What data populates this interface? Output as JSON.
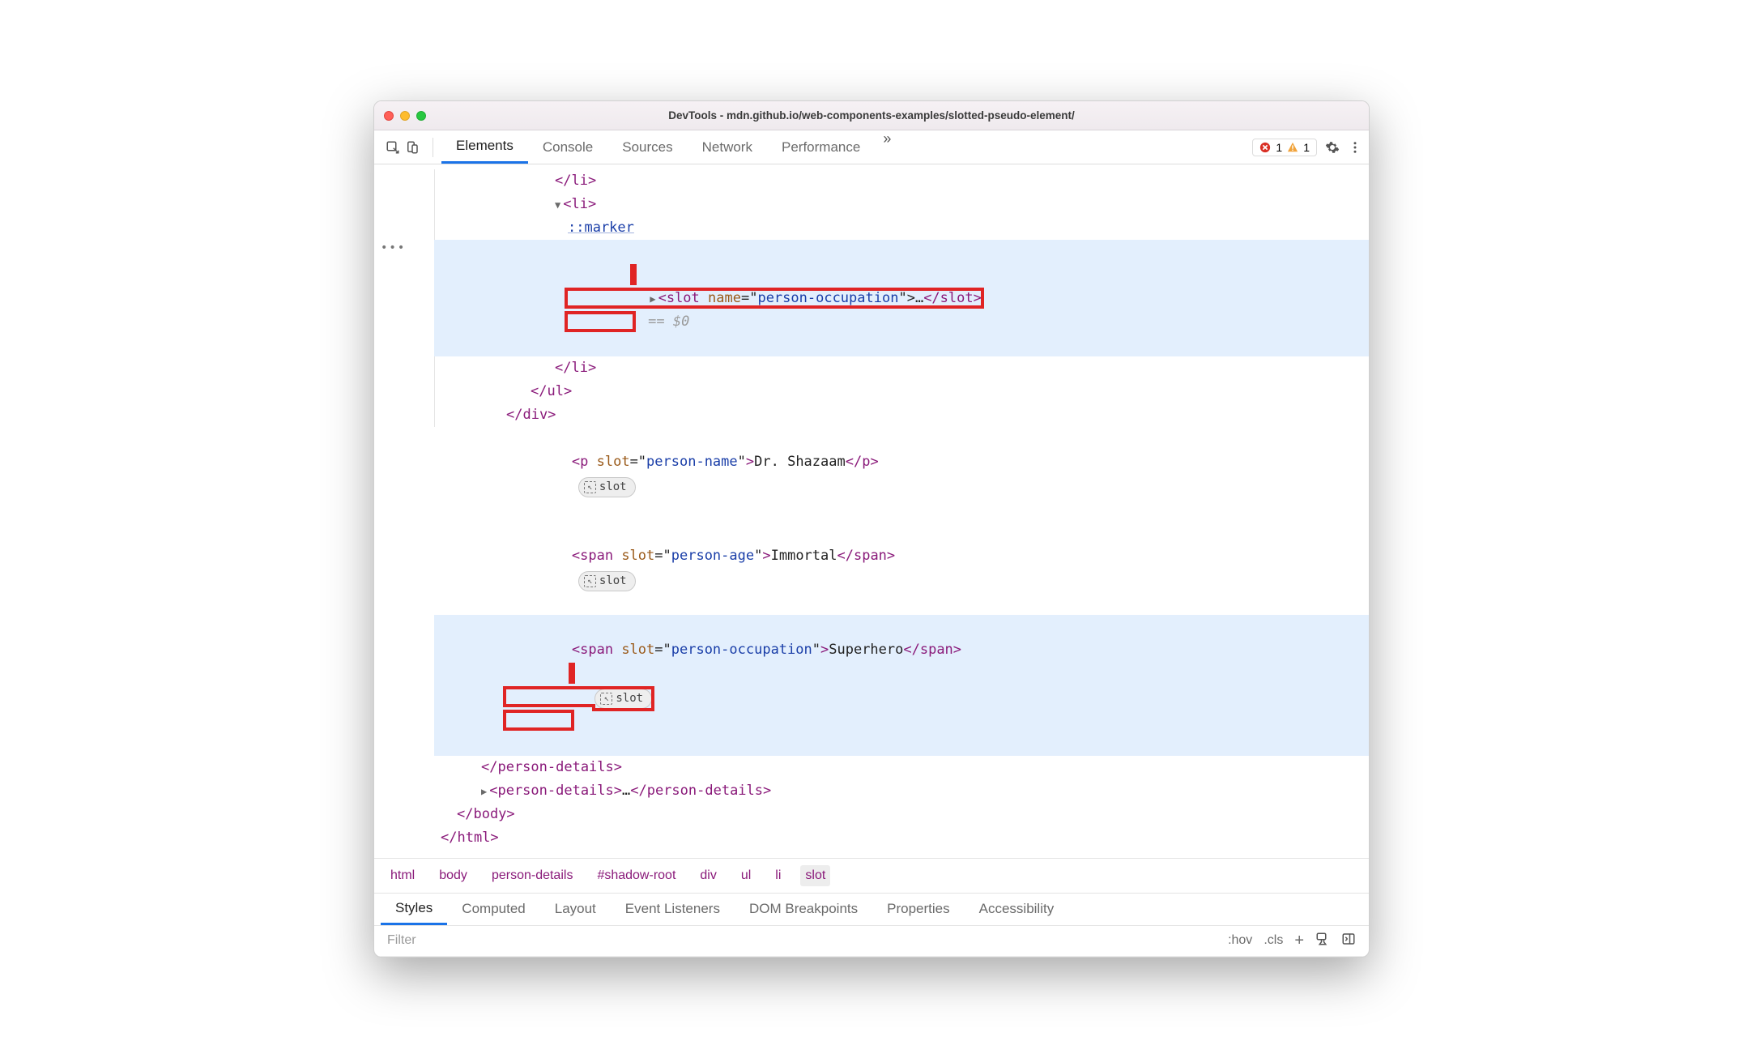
{
  "window_title": "DevTools - mdn.github.io/web-components-examples/slotted-pseudo-element/",
  "tabs": {
    "elements": "Elements",
    "console": "Console",
    "sources": "Sources",
    "network": "Network",
    "performance": "Performance"
  },
  "errors_count": "1",
  "warnings_count": "1",
  "tree": {
    "l0": "</li>",
    "l1": "<li>",
    "l2": "::marker",
    "slot_open": "<slot ",
    "slot_attr_name": "name",
    "slot_attr_eq": "=\"",
    "slot_attr_val": "person-occupation",
    "slot_attr_close": "\">",
    "slot_ellipsis": "…",
    "slot_close": "</slot>",
    "eq0": " == $0",
    "l4": "</li>",
    "l5": "</ul>",
    "l6": "</div>",
    "p_open": "<p ",
    "p_attr_name": "slot",
    "p_attr_val": "person-name",
    "p_after_attr": ">",
    "p_text": "Dr. Shazaam",
    "p_close": "</p>",
    "span1_open": "<span ",
    "span1_attr_name": "slot",
    "span1_attr_val": "person-age",
    "span1_after_attr": ">",
    "span1_text": "Immortal",
    "span1_close": "</span>",
    "span2_open": "<span ",
    "span2_attr_name": "slot",
    "span2_attr_val": "person-occupation",
    "span2_after_attr": ">",
    "span2_text": "Superhero",
    "span2_close": "</span>",
    "pd_close": "</person-details>",
    "pd2_open": "<person-details>",
    "pd2_ellipsis": "…",
    "pd2_close": "</person-details>",
    "body_close": "</body>",
    "html_close": "</html>",
    "slot_badge_label": "slot"
  },
  "crumbs": [
    "html",
    "body",
    "person-details",
    "#shadow-root",
    "div",
    "ul",
    "li",
    "slot"
  ],
  "subtabs": [
    "Styles",
    "Computed",
    "Layout",
    "Event Listeners",
    "DOM Breakpoints",
    "Properties",
    "Accessibility"
  ],
  "filter": {
    "placeholder": "Filter",
    "hov": ":hov",
    "cls": ".cls"
  }
}
